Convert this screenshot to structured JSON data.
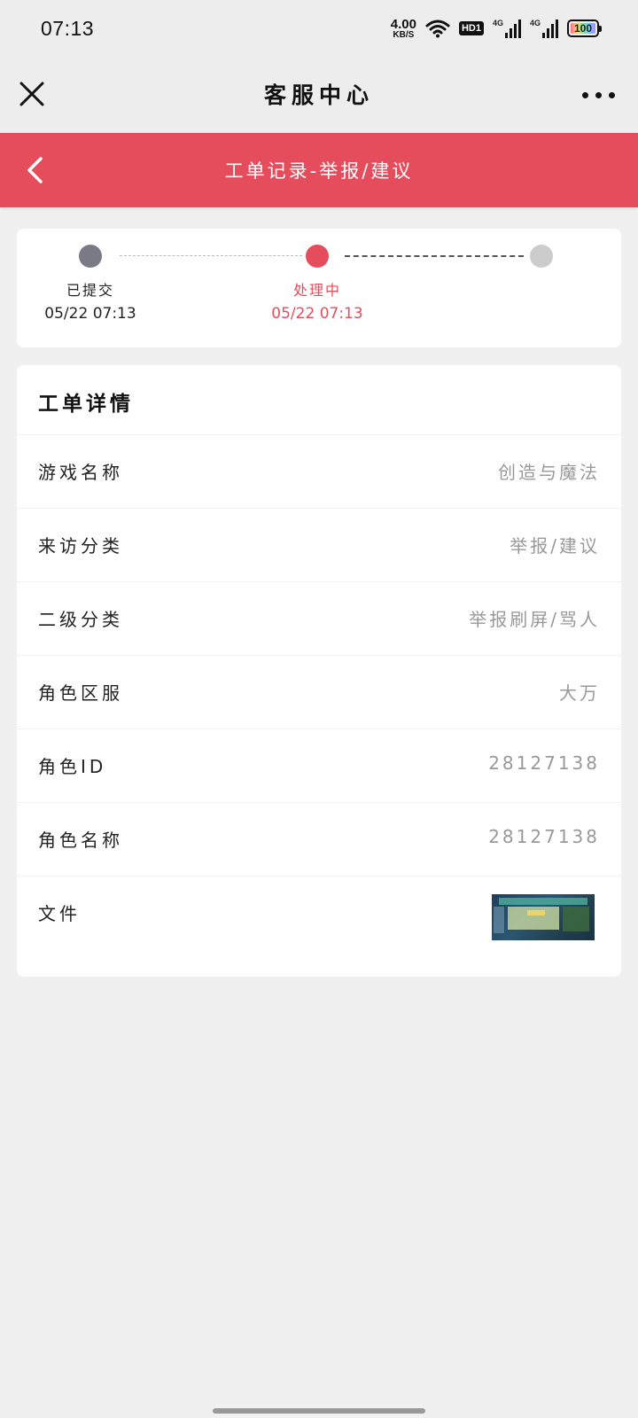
{
  "status_bar": {
    "time": "07:13",
    "net_speed_value": "4.00",
    "net_speed_unit": "KB/S",
    "hd_badge": "HD1",
    "signal1_label": "4G",
    "signal2_label": "4G",
    "battery_level": "100"
  },
  "top_nav": {
    "title": "客服中心",
    "close_icon": "close-icon",
    "more_icon": "more-dots-icon"
  },
  "header": {
    "title": "工单记录-举报/建议",
    "back_icon": "chevron-left-icon",
    "color": "#e54d5c"
  },
  "progress": {
    "steps": [
      {
        "label": "已提交",
        "time": "05/22 07:13",
        "color": "#7a7a86"
      },
      {
        "label": "处理中",
        "time": "05/22 07:13",
        "color": "#e54d5c"
      },
      {
        "label": "",
        "time": "",
        "color": "#cccccc"
      }
    ]
  },
  "details": {
    "title": "工单详情",
    "rows": [
      {
        "label": "游戏名称",
        "value": "创造与魔法"
      },
      {
        "label": "来访分类",
        "value": "举报/建议"
      },
      {
        "label": "二级分类",
        "value": "举报刷屏/骂人"
      },
      {
        "label": "角色区服",
        "value": "大万"
      },
      {
        "label": "角色ID",
        "value": "28127138"
      },
      {
        "label": "角色名称",
        "value": "28127138"
      },
      {
        "label": "文件",
        "value": ""
      }
    ]
  }
}
